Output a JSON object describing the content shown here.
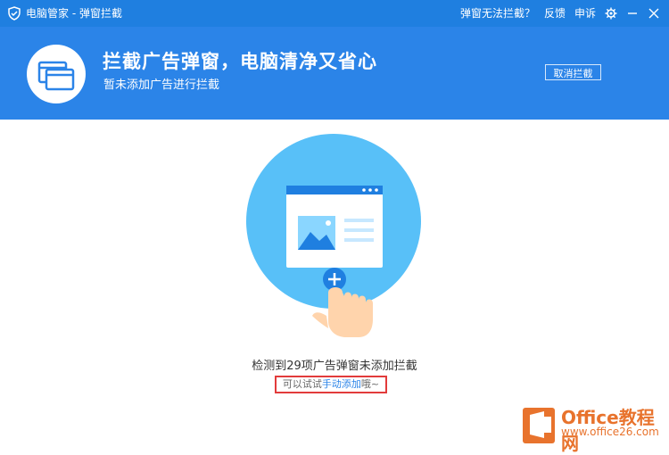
{
  "window": {
    "title": "电脑管家 - 弹窗拦截",
    "links": [
      "弹窗无法拦截？",
      "反馈",
      "申诉"
    ]
  },
  "header": {
    "title": "拦截广告弹窗，电脑清净又省心",
    "subtitle": "暂未添加广告进行拦截",
    "cancel_button": "取消拦截"
  },
  "content": {
    "detect_text": "检测到29项广告弹窗未添加拦截",
    "hint_prefix": "可以试试",
    "hint_link": "手动添加",
    "hint_suffix": "哦~"
  },
  "watermark": {
    "brand": "Office教程网",
    "url": "www.office26.com"
  },
  "colors": {
    "titlebar": "#1f7fe0",
    "header": "#2b84e8",
    "accent": "#2b84e8",
    "highlight_border": "#e23b3b",
    "illus_circle": "#58c0f8"
  },
  "icons": [
    "shield-icon",
    "gear-icon",
    "minimize-icon",
    "close-icon",
    "window-icon",
    "add-icon",
    "hand-pointer-icon",
    "image-icon"
  ]
}
